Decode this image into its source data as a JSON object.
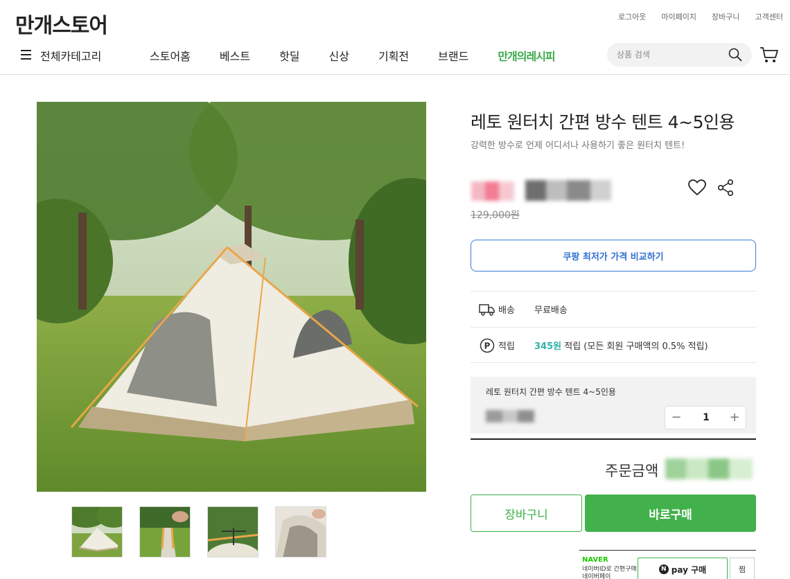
{
  "header": {
    "logo": "만개스토어",
    "util_links": [
      "로그아웃",
      "마이페이지",
      "장바구니",
      "고객센터"
    ],
    "all_categories": "전체카테고리",
    "menu": [
      "스토어홈",
      "베스트",
      "핫딜",
      "신상",
      "기획전",
      "브랜드"
    ],
    "special_menu": "만개의레시피",
    "search_placeholder": "상품 검색"
  },
  "product": {
    "title": "레토 원터치 간편 방수 텐트 4~5인용",
    "subtitle": "강력한 방수로 언제 어디서나 사용하기 좋은 원터치 텐트!",
    "original_price": "129,000원",
    "compare_button": "쿠팡 최저가 가격 비교하기",
    "shipping": {
      "label": "배송",
      "value": "무료배송"
    },
    "points": {
      "label": "적립",
      "amount": "345원",
      "desc": " 적립 (모든 회원 구매액의 0.5% 적립)"
    },
    "option": {
      "name": "레토 원터치 간편 방수 텐트 4~5인용",
      "quantity": "1",
      "minus": "−",
      "plus": "+"
    },
    "total_label": "주문금액",
    "cart_button": "장바구니",
    "buy_button": "바로구매",
    "naver": {
      "logo": "NAVER",
      "desc": "네이버ID로 간편구매 네이버페이",
      "pay_n": "N",
      "pay_button": "pay 구매",
      "zzim": "찜"
    }
  },
  "colors": {
    "brand_green": "#43b14b",
    "compare_blue": "#2f6fd0",
    "points_teal": "#2fb3a7"
  }
}
